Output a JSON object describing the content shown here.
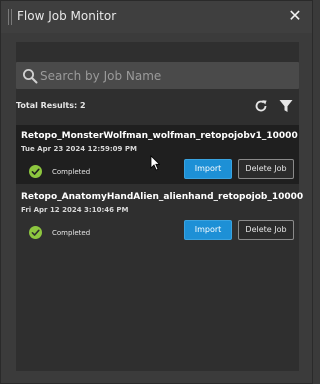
{
  "window": {
    "title": "Flow Job Monitor",
    "close_icon": "close-icon"
  },
  "search": {
    "placeholder": "Search by Job Name",
    "value": "",
    "icon": "search-icon"
  },
  "results": {
    "total_label": "Total Results: 2",
    "refresh_icon": "refresh-icon",
    "filter_icon": "filter-icon"
  },
  "jobs": [
    {
      "name": "Retopo_MonsterWolfman_wolfman_retopojobv1_10000",
      "date": "Tue Apr 23 2024 12:59:09 PM",
      "status": "Completed",
      "import_label": "Import",
      "delete_label": "Delete Job",
      "selected": true
    },
    {
      "name": "Retopo_AnatomyHandAlien_alienhand_retopojob_10000",
      "date": "Fri Apr 12 2024 3:10:46 PM",
      "status": "Completed",
      "import_label": "Import",
      "delete_label": "Delete Job",
      "selected": false
    }
  ],
  "colors": {
    "accent": "#1d90d6",
    "status_ok": "#8dc63f",
    "selected_row": "#1f1f1f"
  }
}
